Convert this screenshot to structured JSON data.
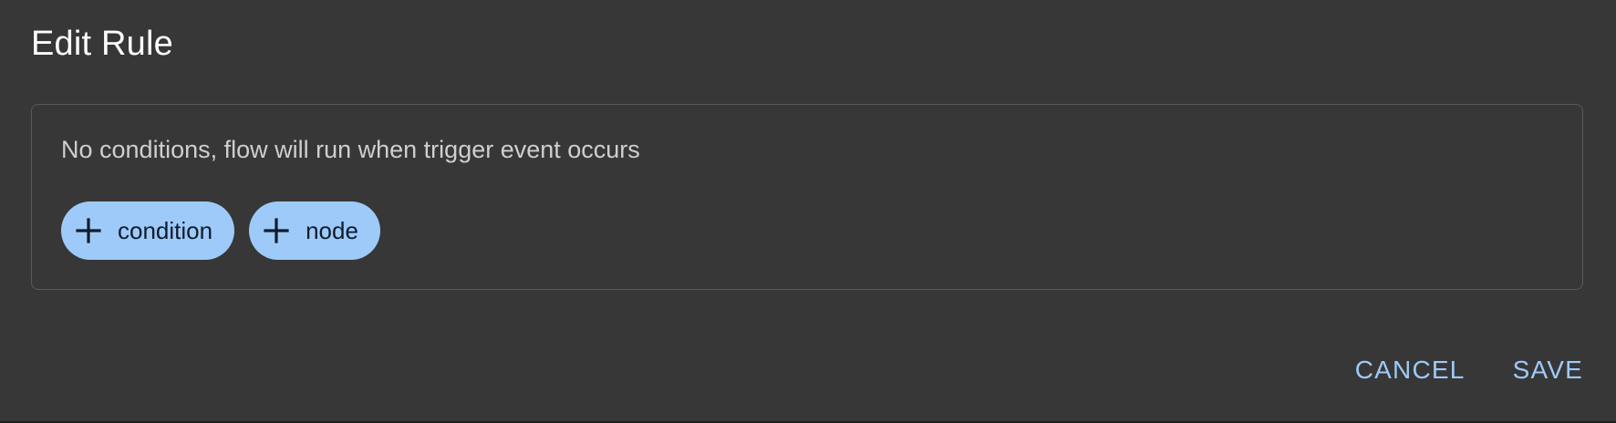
{
  "dialog": {
    "title": "Edit Rule"
  },
  "conditions": {
    "empty_message": "No conditions, flow will run when trigger event occurs",
    "add_condition": {
      "icon": "plus-icon",
      "label": "condition"
    },
    "add_node": {
      "icon": "plus-icon",
      "label": "node"
    }
  },
  "actions": {
    "cancel_label": "CANCEL",
    "save_label": "SAVE"
  },
  "colors": {
    "dialog_background": "#373737",
    "chip_background": "#9ecaf9",
    "accent_text": "#9ecaf9",
    "title_text": "#ffffff",
    "body_text": "#cfcfcf"
  }
}
